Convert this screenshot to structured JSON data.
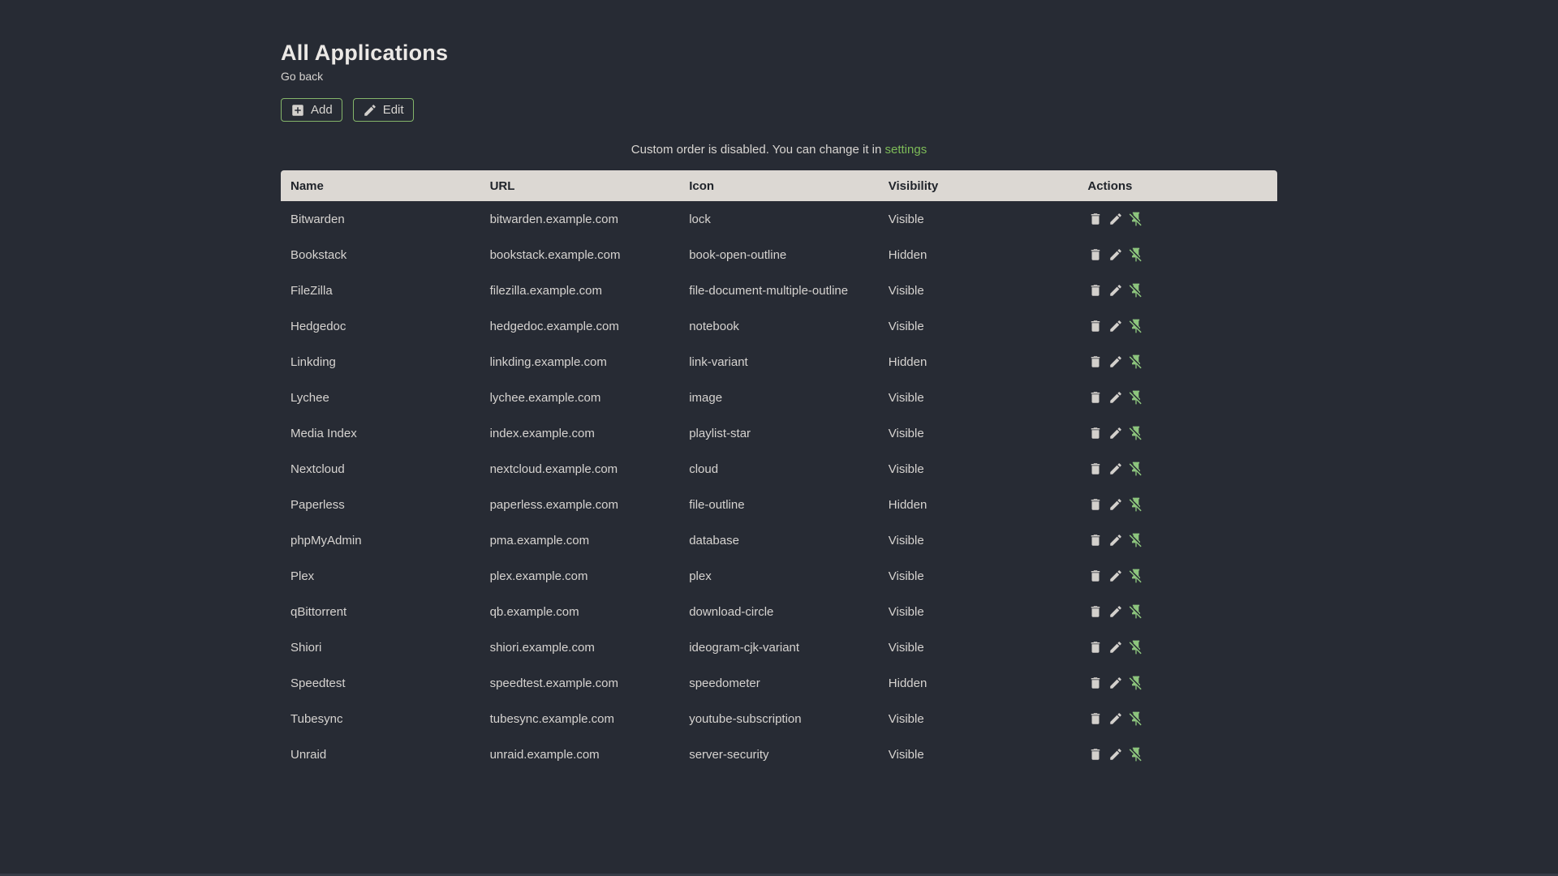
{
  "page": {
    "title": "All Applications",
    "back_link": "Go back",
    "notice_text": "Custom order is disabled. You can change it in",
    "notice_link": "settings"
  },
  "toolbar": {
    "add_label": "Add",
    "edit_label": "Edit"
  },
  "icons": {
    "add_button": "plus-box-icon",
    "edit_button": "pencil-icon",
    "row_actions": [
      "delete-icon",
      "pencil-icon",
      "pin-off-icon"
    ]
  },
  "colors": {
    "page_background": "#272b34",
    "table_header_background": "#dcd8d3",
    "table_header_text": "#20242b",
    "body_text": "#d6d3d0",
    "accent_green_border": "#84b56a",
    "link_green": "#7dbb58",
    "pin_icon_green": "#8dc57d"
  },
  "table": {
    "headers": [
      "Name",
      "URL",
      "Icon",
      "Visibility",
      "Actions"
    ],
    "rows": [
      {
        "name": "Bitwarden",
        "url": "bitwarden.example.com",
        "icon": "lock",
        "visibility": "Visible"
      },
      {
        "name": "Bookstack",
        "url": "bookstack.example.com",
        "icon": "book-open-outline",
        "visibility": "Hidden"
      },
      {
        "name": "FileZilla",
        "url": "filezilla.example.com",
        "icon": "file-document-multiple-outline",
        "visibility": "Visible"
      },
      {
        "name": "Hedgedoc",
        "url": "hedgedoc.example.com",
        "icon": "notebook",
        "visibility": "Visible"
      },
      {
        "name": "Linkding",
        "url": "linkding.example.com",
        "icon": "link-variant",
        "visibility": "Hidden"
      },
      {
        "name": "Lychee",
        "url": "lychee.example.com",
        "icon": "image",
        "visibility": "Visible"
      },
      {
        "name": "Media Index",
        "url": "index.example.com",
        "icon": "playlist-star",
        "visibility": "Visible"
      },
      {
        "name": "Nextcloud",
        "url": "nextcloud.example.com",
        "icon": "cloud",
        "visibility": "Visible"
      },
      {
        "name": "Paperless",
        "url": "paperless.example.com",
        "icon": "file-outline",
        "visibility": "Hidden"
      },
      {
        "name": "phpMyAdmin",
        "url": "pma.example.com",
        "icon": "database",
        "visibility": "Visible"
      },
      {
        "name": "Plex",
        "url": "plex.example.com",
        "icon": "plex",
        "visibility": "Visible"
      },
      {
        "name": "qBittorrent",
        "url": "qb.example.com",
        "icon": "download-circle",
        "visibility": "Visible"
      },
      {
        "name": "Shiori",
        "url": "shiori.example.com",
        "icon": "ideogram-cjk-variant",
        "visibility": "Visible"
      },
      {
        "name": "Speedtest",
        "url": "speedtest.example.com",
        "icon": "speedometer",
        "visibility": "Hidden"
      },
      {
        "name": "Tubesync",
        "url": "tubesync.example.com",
        "icon": "youtube-subscription",
        "visibility": "Visible"
      },
      {
        "name": "Unraid",
        "url": "unraid.example.com",
        "icon": "server-security",
        "visibility": "Visible"
      }
    ]
  }
}
